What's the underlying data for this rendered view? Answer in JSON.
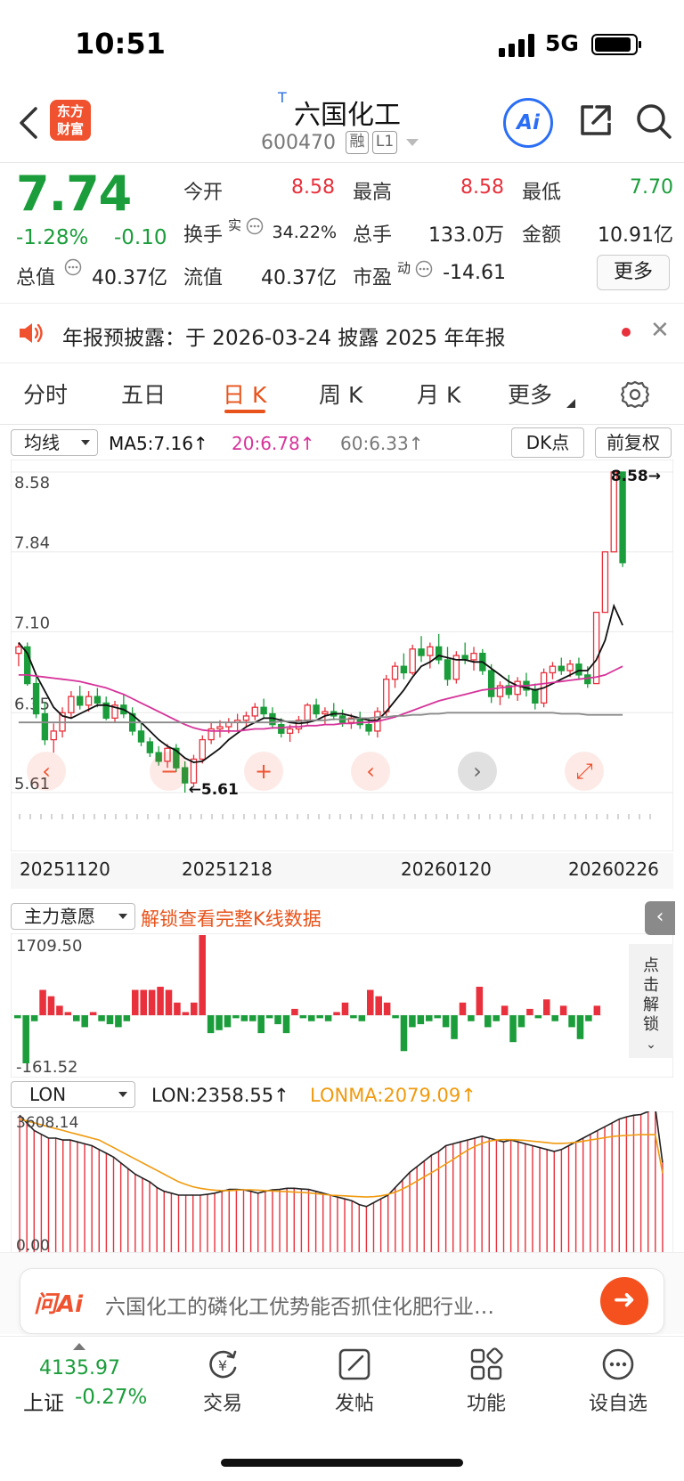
{
  "status": {
    "time": "10:51",
    "network": "5G"
  },
  "header": {
    "logo": [
      "东方",
      "财富"
    ],
    "tag": "T",
    "name": "六国化工",
    "code": "600470",
    "badges": [
      "融",
      "L1"
    ],
    "ai": "Ai"
  },
  "quote": {
    "price": "7.74",
    "change_pct": "-1.28%",
    "change_amt": "-0.10",
    "fields": {
      "open_label": "今开",
      "open": "8.58",
      "high_label": "最高",
      "high": "8.58",
      "low_label": "最低",
      "low": "7.70",
      "turnover_label": "换手",
      "turnover_sup": "实",
      "turnover": "34.22%",
      "volume_label": "总手",
      "volume": "133.0万",
      "amount_label": "金额",
      "amount": "10.91亿",
      "mktcap_label": "总值",
      "mktcap": "40.37亿",
      "float_label": "流值",
      "float": "40.37亿",
      "pe_label": "市盈",
      "pe_sup": "动",
      "pe": "-14.61"
    },
    "more": "更多"
  },
  "notice": {
    "text": "年报预披露：于 2026-03-24 披露 2025 年年报"
  },
  "tabs": [
    "分时",
    "五日",
    "日 K",
    "周 K",
    "月 K",
    "更多"
  ],
  "ma_row": {
    "dropdown": "均线",
    "ma5": "MA5:7.16↑",
    "ma20": "20:6.78↑",
    "ma60": "60:6.33↑",
    "dk": "DK点",
    "adjust": "前复权"
  },
  "colors": {
    "up": "#e8313c",
    "down": "#1a9d3a",
    "accent": "#e8531b",
    "ma5": "#111111",
    "ma20": "#d6339a",
    "ma60": "#8a8a8a",
    "lonma": "#f09a0e"
  },
  "chart_data": [
    {
      "type": "candlestick",
      "y_ticks": [
        "8.58",
        "7.84",
        "7.10",
        "6.35",
        "5.61"
      ],
      "ylim": [
        5.61,
        8.58
      ],
      "x_tick_labels": [
        "20251120",
        "20251218",
        "20260120",
        "20260226"
      ],
      "annotations": {
        "max": "8.58→",
        "min": "←5.61"
      },
      "candles": [
        [
          6.9,
          7.0,
          6.78,
          6.96
        ],
        [
          6.96,
          7.0,
          6.6,
          6.62
        ],
        [
          6.62,
          6.7,
          6.3,
          6.34
        ],
        [
          6.34,
          6.45,
          6.05,
          6.1
        ],
        [
          6.1,
          6.25,
          5.98,
          6.18
        ],
        [
          6.18,
          6.4,
          6.12,
          6.35
        ],
        [
          6.35,
          6.55,
          6.3,
          6.5
        ],
        [
          6.5,
          6.6,
          6.38,
          6.42
        ],
        [
          6.42,
          6.55,
          6.36,
          6.5
        ],
        [
          6.5,
          6.58,
          6.4,
          6.44
        ],
        [
          6.44,
          6.5,
          6.28,
          6.3
        ],
        [
          6.3,
          6.46,
          6.26,
          6.42
        ],
        [
          6.42,
          6.52,
          6.3,
          6.34
        ],
        [
          6.34,
          6.4,
          6.14,
          6.18
        ],
        [
          6.18,
          6.26,
          6.04,
          6.08
        ],
        [
          6.08,
          6.12,
          5.94,
          5.98
        ],
        [
          5.98,
          6.04,
          5.86,
          5.9
        ],
        [
          5.9,
          6.06,
          5.84,
          6.02
        ],
        [
          6.02,
          6.06,
          5.8,
          5.84
        ],
        [
          5.84,
          5.9,
          5.61,
          5.7
        ],
        [
          5.7,
          5.96,
          5.66,
          5.92
        ],
        [
          5.92,
          6.14,
          5.88,
          6.1
        ],
        [
          6.1,
          6.26,
          6.06,
          6.2
        ],
        [
          6.2,
          6.28,
          6.12,
          6.22
        ],
        [
          6.22,
          6.3,
          6.16,
          6.26
        ],
        [
          6.26,
          6.34,
          6.18,
          6.28
        ],
        [
          6.28,
          6.36,
          6.22,
          6.32
        ],
        [
          6.32,
          6.44,
          6.28,
          6.4
        ],
        [
          6.4,
          6.48,
          6.3,
          6.34
        ],
        [
          6.34,
          6.4,
          6.2,
          6.24
        ],
        [
          6.24,
          6.3,
          6.12,
          6.16
        ],
        [
          6.16,
          6.24,
          6.08,
          6.2
        ],
        [
          6.2,
          6.32,
          6.16,
          6.28
        ],
        [
          6.28,
          6.44,
          6.24,
          6.42
        ],
        [
          6.42,
          6.48,
          6.3,
          6.34
        ],
        [
          6.34,
          6.4,
          6.24,
          6.36
        ],
        [
          6.36,
          6.44,
          6.28,
          6.32
        ],
        [
          6.32,
          6.38,
          6.22,
          6.26
        ],
        [
          6.26,
          6.34,
          6.2,
          6.3
        ],
        [
          6.3,
          6.36,
          6.2,
          6.24
        ],
        [
          6.24,
          6.3,
          6.14,
          6.18
        ],
        [
          6.18,
          6.4,
          6.12,
          6.36
        ],
        [
          6.36,
          6.7,
          6.32,
          6.66
        ],
        [
          6.66,
          6.82,
          6.58,
          6.78
        ],
        [
          6.78,
          6.9,
          6.66,
          6.72
        ],
        [
          6.72,
          6.98,
          6.7,
          6.94
        ],
        [
          6.94,
          7.06,
          6.82,
          6.88
        ],
        [
          6.88,
          7.0,
          6.76,
          6.96
        ],
        [
          6.96,
          7.08,
          6.8,
          6.84
        ],
        [
          6.84,
          6.96,
          6.6,
          6.66
        ],
        [
          6.66,
          6.92,
          6.62,
          6.88
        ],
        [
          6.88,
          7.0,
          6.8,
          6.84
        ],
        [
          6.84,
          6.96,
          6.74,
          6.9
        ],
        [
          6.9,
          6.94,
          6.7,
          6.74
        ],
        [
          6.74,
          6.8,
          6.44,
          6.5
        ],
        [
          6.5,
          6.64,
          6.42,
          6.6
        ],
        [
          6.6,
          6.7,
          6.48,
          6.52
        ],
        [
          6.52,
          6.68,
          6.46,
          6.64
        ],
        [
          6.64,
          6.72,
          6.5,
          6.56
        ],
        [
          6.56,
          6.62,
          6.38,
          6.44
        ],
        [
          6.44,
          6.76,
          6.4,
          6.72
        ],
        [
          6.72,
          6.82,
          6.66,
          6.78
        ],
        [
          6.78,
          6.86,
          6.7,
          6.74
        ],
        [
          6.74,
          6.84,
          6.68,
          6.8
        ],
        [
          6.8,
          6.86,
          6.66,
          6.7
        ],
        [
          6.7,
          6.78,
          6.58,
          6.62
        ],
        [
          6.62,
          7.28,
          6.62,
          7.28
        ],
        [
          7.28,
          7.84,
          7.28,
          7.84
        ],
        [
          7.84,
          8.58,
          7.84,
          8.58
        ],
        [
          8.58,
          8.58,
          7.7,
          7.74
        ]
      ],
      "ma_series": [
        {
          "name": "MA5",
          "values": [
            7.0,
            6.9,
            6.7,
            6.55,
            6.4,
            6.32,
            6.3,
            6.34,
            6.38,
            6.42,
            6.42,
            6.4,
            6.38,
            6.33,
            6.26,
            6.18,
            6.1,
            6.04,
            6.0,
            5.93,
            5.89,
            5.9,
            5.96,
            6.02,
            6.1,
            6.16,
            6.22,
            6.26,
            6.3,
            6.3,
            6.28,
            6.26,
            6.25,
            6.26,
            6.28,
            6.32,
            6.34,
            6.34,
            6.32,
            6.3,
            6.28,
            6.28,
            6.36,
            6.46,
            6.56,
            6.68,
            6.78,
            6.82,
            6.88,
            6.86,
            6.84,
            6.84,
            6.82,
            6.82,
            6.76,
            6.7,
            6.64,
            6.6,
            6.58,
            6.56,
            6.58,
            6.62,
            6.66,
            6.7,
            6.74,
            6.74,
            6.84,
            7.02,
            7.34,
            7.16
          ]
        },
        {
          "name": "20",
          "values": [
            6.7,
            6.7,
            6.69,
            6.68,
            6.67,
            6.66,
            6.65,
            6.64,
            6.62,
            6.6,
            6.58,
            6.55,
            6.52,
            6.48,
            6.44,
            6.4,
            6.36,
            6.32,
            6.28,
            6.24,
            6.21,
            6.19,
            6.18,
            6.18,
            6.18,
            6.18,
            6.19,
            6.2,
            6.2,
            6.21,
            6.21,
            6.22,
            6.22,
            6.23,
            6.23,
            6.24,
            6.24,
            6.25,
            6.25,
            6.26,
            6.26,
            6.27,
            6.29,
            6.31,
            6.34,
            6.37,
            6.4,
            6.43,
            6.46,
            6.48,
            6.5,
            6.52,
            6.54,
            6.56,
            6.57,
            6.58,
            6.59,
            6.6,
            6.6,
            6.61,
            6.62,
            6.63,
            6.64,
            6.65,
            6.66,
            6.67,
            6.68,
            6.7,
            6.74,
            6.78
          ]
        },
        {
          "name": "60",
          "values": [
            6.26,
            6.26,
            6.26,
            6.26,
            6.26,
            6.26,
            6.26,
            6.26,
            6.26,
            6.26,
            6.26,
            6.26,
            6.26,
            6.26,
            6.26,
            6.26,
            6.26,
            6.26,
            6.26,
            6.26,
            6.26,
            6.26,
            6.26,
            6.26,
            6.26,
            6.26,
            6.26,
            6.26,
            6.26,
            6.26,
            6.27,
            6.27,
            6.27,
            6.28,
            6.28,
            6.28,
            6.29,
            6.29,
            6.29,
            6.3,
            6.3,
            6.31,
            6.31,
            6.32,
            6.32,
            6.33,
            6.33,
            6.34,
            6.34,
            6.35,
            6.35,
            6.35,
            6.35,
            6.35,
            6.35,
            6.35,
            6.35,
            6.35,
            6.35,
            6.35,
            6.35,
            6.35,
            6.34,
            6.34,
            6.34,
            6.33,
            6.33,
            6.33,
            6.33,
            6.33
          ]
        }
      ]
    },
    {
      "type": "bar",
      "title": "主力意愿",
      "y_ticks": [
        "1709.50",
        "-161.52"
      ],
      "ylim": [
        -161.52,
        1709.5
      ],
      "values": [
        -10,
        -161,
        -20,
        80,
        60,
        30,
        10,
        -20,
        -40,
        10,
        -20,
        -30,
        -40,
        -20,
        80,
        80,
        80,
        90,
        80,
        40,
        10,
        40,
        1709,
        -60,
        -50,
        -40,
        -10,
        -20,
        -20,
        -60,
        -10,
        -30,
        -60,
        20,
        -10,
        -20,
        -10,
        -20,
        10,
        40,
        -10,
        -20,
        80,
        60,
        40,
        -10,
        -120,
        -40,
        -30,
        -20,
        -10,
        -40,
        -80,
        40,
        -20,
        90,
        -40,
        -20,
        30,
        -90,
        -40,
        20,
        -10,
        50,
        -20,
        30,
        -40,
        -80,
        -20,
        30
      ]
    },
    {
      "type": "bar-line",
      "title": "LON",
      "y_ticks": [
        "3608.14",
        "0.00"
      ],
      "ylim": [
        0,
        3608.14
      ],
      "series": [
        {
          "name": "LON",
          "values": [
            3600,
            3400,
            3200,
            3100,
            3000,
            3000,
            2950,
            2950,
            2900,
            2850,
            2800,
            2700,
            2600,
            2500,
            2350,
            2200,
            2050,
            1950,
            1850,
            1700,
            1600,
            1550,
            1500,
            1500,
            1500,
            1500,
            1520,
            1550,
            1600,
            1650,
            1650,
            1640,
            1600,
            1550,
            1600,
            1640,
            1650,
            1680,
            1680,
            1660,
            1650,
            1600,
            1550,
            1500,
            1450,
            1400,
            1350,
            1250,
            1200,
            1300,
            1400,
            1500,
            1700,
            1900,
            2100,
            2250,
            2400,
            2550,
            2650,
            2800,
            2850,
            2900,
            2950,
            3000,
            3050,
            3000,
            2950,
            2900,
            2950,
            2900,
            2850,
            2800,
            2750,
            2700,
            2650,
            2700,
            2800,
            2900,
            3000,
            3100,
            3200,
            3300,
            3400,
            3500,
            3560,
            3600,
            3620,
            3700,
            3800,
            2358
          ]
        },
        {
          "name": "LONMA",
          "values": [
            3500,
            3450,
            3400,
            3350,
            3300,
            3250,
            3200,
            3150,
            3100,
            3050,
            3000,
            2950,
            2850,
            2750,
            2650,
            2550,
            2450,
            2350,
            2250,
            2150,
            2050,
            1950,
            1850,
            1780,
            1720,
            1680,
            1650,
            1630,
            1620,
            1620,
            1630,
            1640,
            1640,
            1630,
            1620,
            1610,
            1600,
            1590,
            1580,
            1570,
            1560,
            1540,
            1520,
            1500,
            1490,
            1480,
            1470,
            1460,
            1450,
            1460,
            1480,
            1520,
            1580,
            1660,
            1760,
            1870,
            1980,
            2090,
            2200,
            2320,
            2440,
            2560,
            2680,
            2780,
            2860,
            2920,
            2950,
            2960,
            2960,
            2950,
            2940,
            2920,
            2900,
            2880,
            2860,
            2860,
            2870,
            2890,
            2920,
            2950,
            2980,
            3010,
            3040,
            3060,
            3070,
            3080,
            3090,
            3090,
            3090,
            2079
          ]
        }
      ]
    }
  ],
  "volume": {
    "dropdown": "主力意愿",
    "unlock": "解锁查看完整K线数据",
    "side": [
      "点",
      "击",
      "解",
      "锁"
    ]
  },
  "lon": {
    "dropdown": "LON",
    "lon": "LON:2358.55↑",
    "lonma": "LONMA:2079.09↑"
  },
  "ask": {
    "logo": "问Ai",
    "text": "六国化工的磷化工优势能否抓住化肥行业…"
  },
  "nav": {
    "index_value": "4135.97",
    "index_name": "上证",
    "index_change": "-0.27%",
    "items": [
      "交易",
      "发帖",
      "功能",
      "设自选"
    ]
  }
}
